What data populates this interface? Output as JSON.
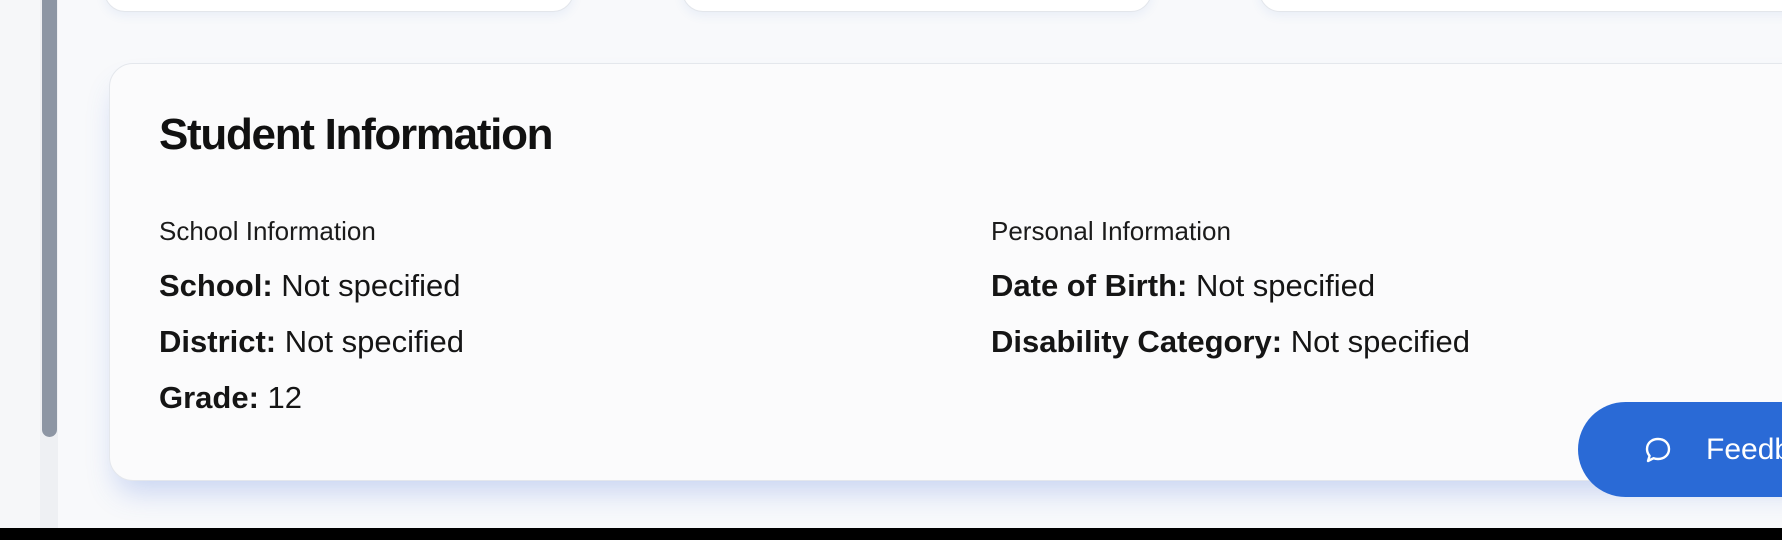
{
  "card": {
    "title": "Student Information",
    "school_section": {
      "heading": "School Information",
      "fields": [
        {
          "label": "School:",
          "value": "Not specified"
        },
        {
          "label": "District:",
          "value": "Not specified"
        },
        {
          "label": "Grade:",
          "value": "12"
        }
      ]
    },
    "personal_section": {
      "heading": "Personal Information",
      "fields": [
        {
          "label": "Date of Birth:",
          "value": "Not specified"
        },
        {
          "label": "Disability Category:",
          "value": "Not specified"
        }
      ]
    }
  },
  "feedback_button": {
    "label": "Feedback",
    "icon": "chat-bubble-icon"
  },
  "colors": {
    "accent": "#2a6ad6",
    "page_background": "#f8f9fb",
    "card_background": "#fbfbfc",
    "scrollbar_thumb": "#8d96a4"
  }
}
